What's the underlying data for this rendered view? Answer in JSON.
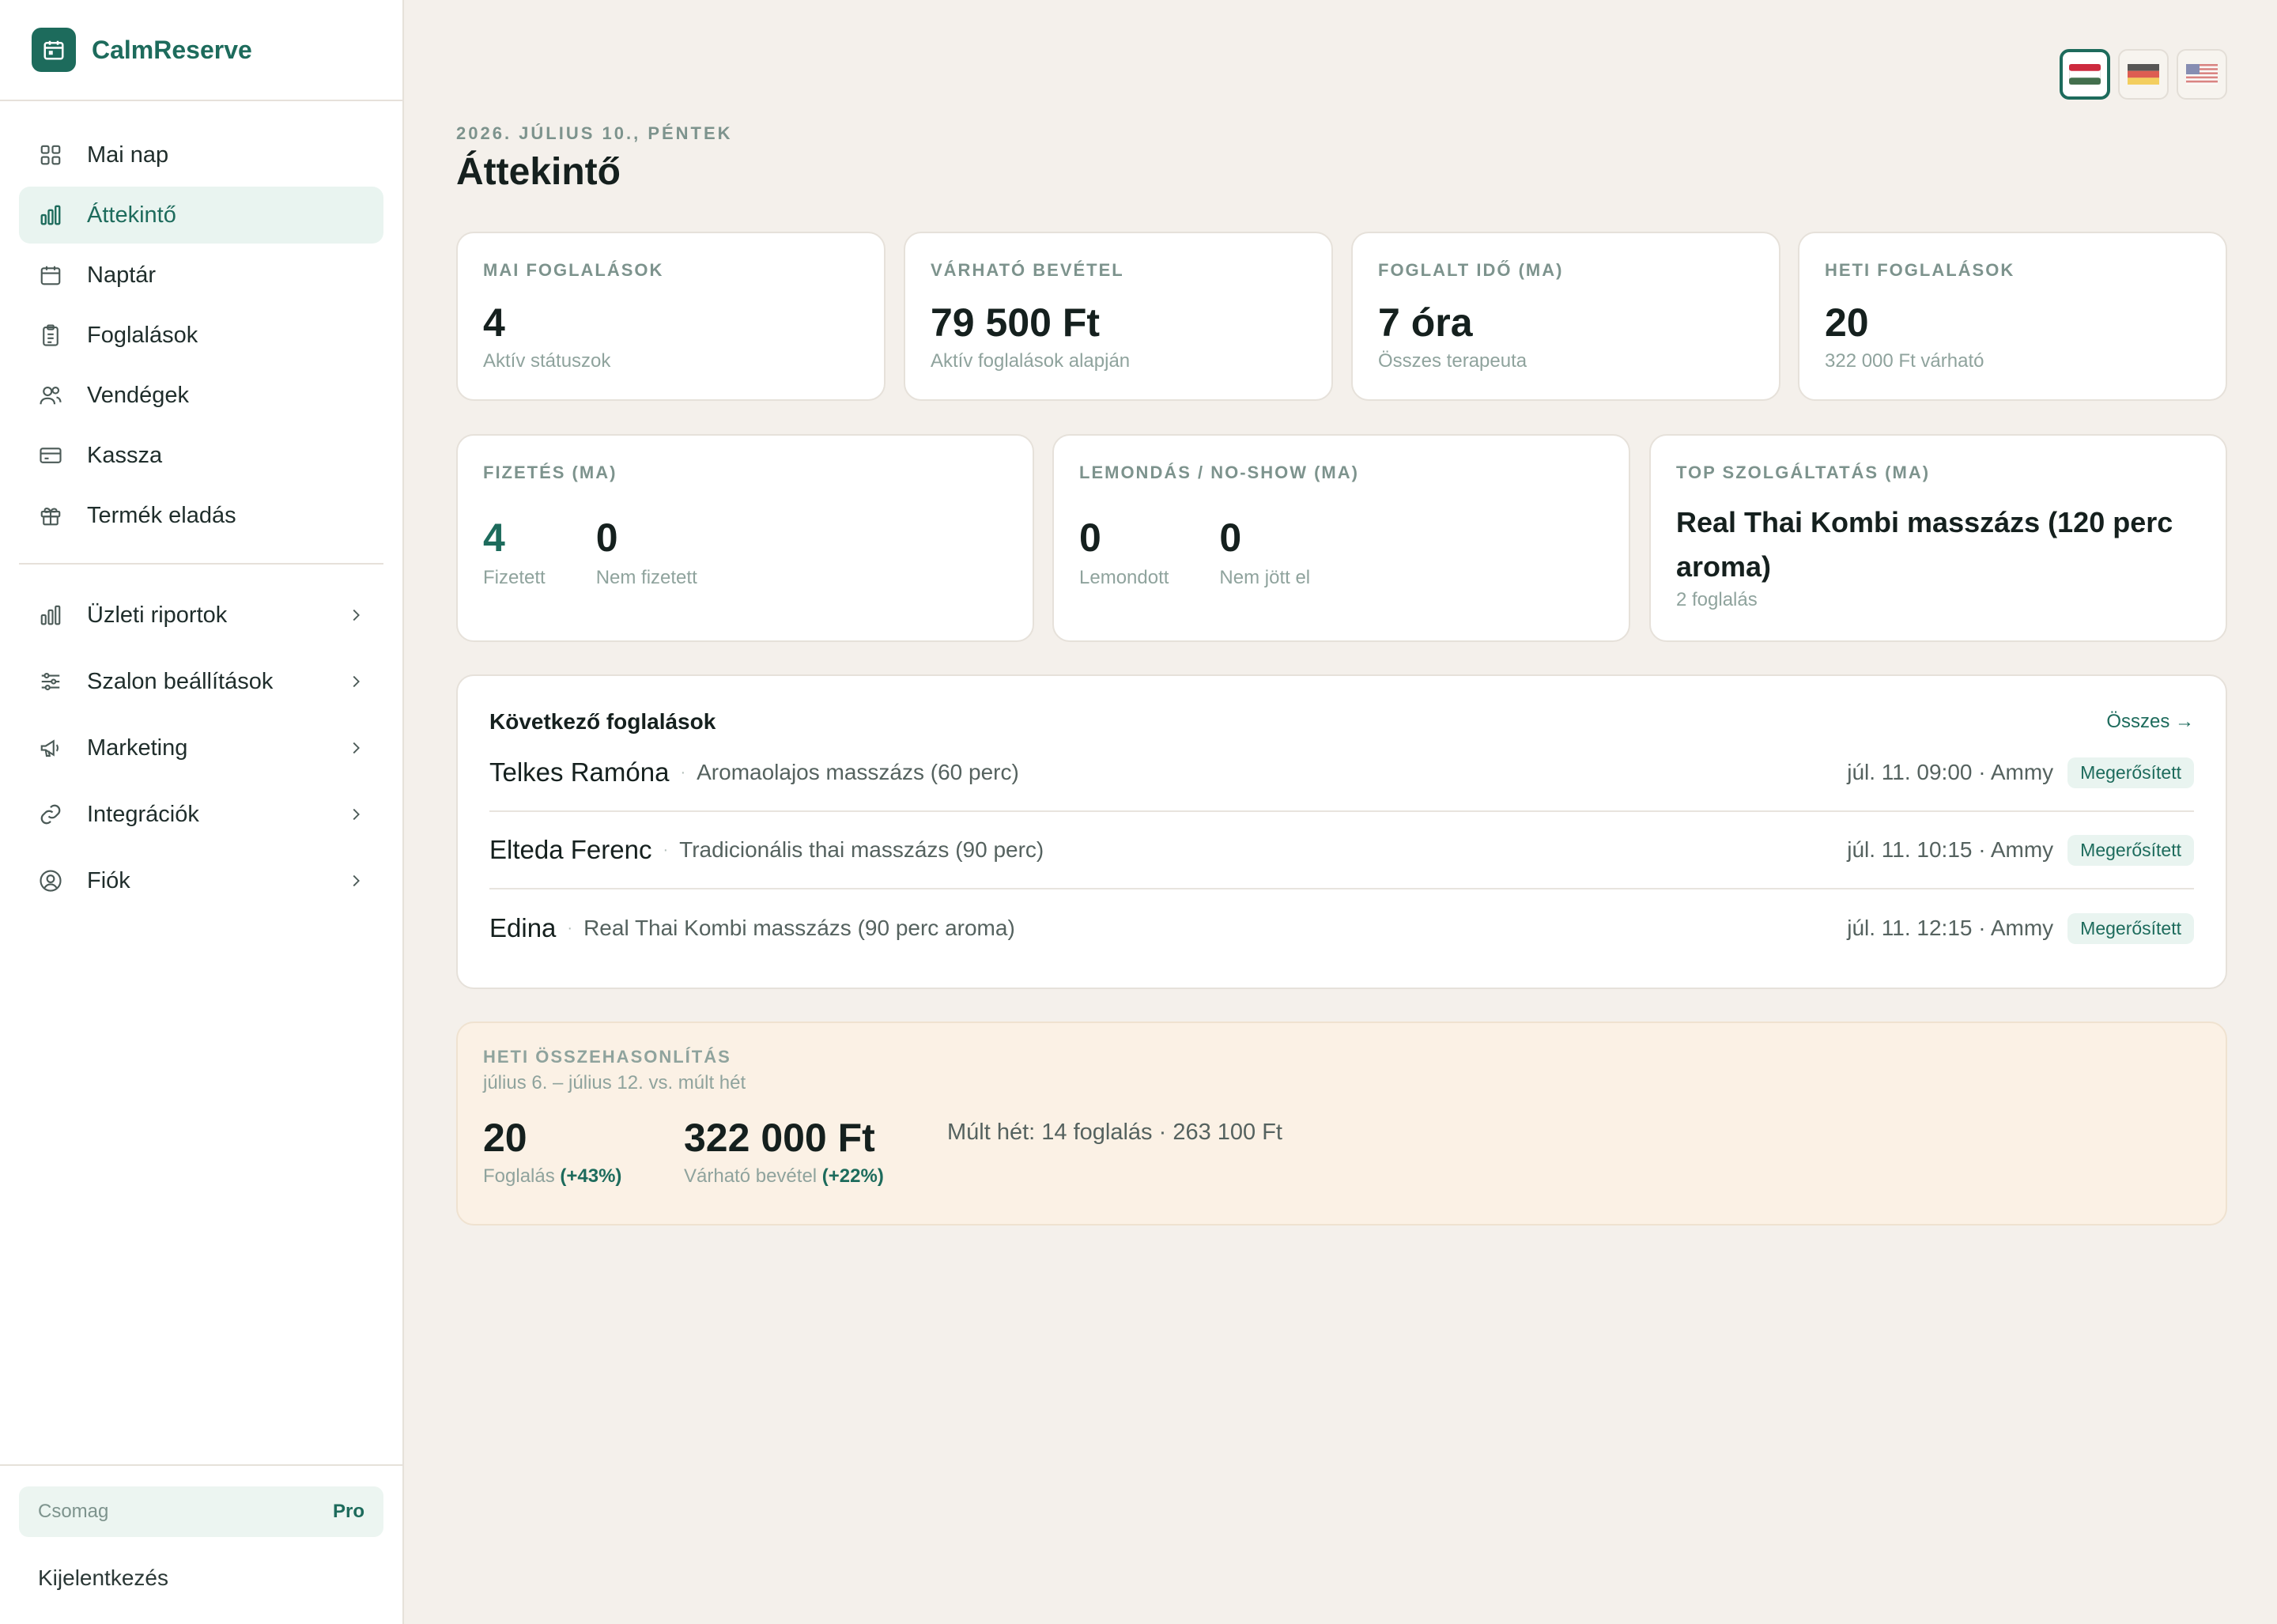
{
  "app": {
    "name": "CalmReserve"
  },
  "sidebar": {
    "items": [
      {
        "label": "Mai nap",
        "icon": "grid-icon"
      },
      {
        "label": "Áttekintő",
        "icon": "bar-chart-icon",
        "active": true
      },
      {
        "label": "Naptár",
        "icon": "calendar-icon"
      },
      {
        "label": "Foglalások",
        "icon": "clipboard-icon"
      },
      {
        "label": "Vendégek",
        "icon": "users-icon"
      },
      {
        "label": "Kassza",
        "icon": "credit-card-icon"
      },
      {
        "label": "Termék eladás",
        "icon": "gift-icon"
      }
    ],
    "groups": [
      {
        "label": "Üzleti riportok",
        "icon": "bar-chart-icon"
      },
      {
        "label": "Szalon beállítások",
        "icon": "sliders-icon"
      },
      {
        "label": "Marketing",
        "icon": "megaphone-icon"
      },
      {
        "label": "Integrációk",
        "icon": "link-icon"
      },
      {
        "label": "Fiók",
        "icon": "user-circle-icon"
      }
    ],
    "plan_label": "Csomag",
    "plan_value": "Pro",
    "logout": "Kijelentkezés"
  },
  "languages": [
    "hu",
    "de",
    "en-us"
  ],
  "active_language": "hu",
  "header": {
    "date": "2026. JÚLIUS 10., PÉNTEK",
    "title": "Áttekintő"
  },
  "stats": [
    {
      "label": "MAI FOGLALÁSOK",
      "value": "4",
      "sub": "Aktív státuszok"
    },
    {
      "label": "VÁRHATÓ BEVÉTEL",
      "value": "79 500 Ft",
      "sub": "Aktív foglalások alapján"
    },
    {
      "label": "FOGLALT IDŐ (MA)",
      "value": "7 óra",
      "sub": "Összes terapeuta"
    },
    {
      "label": "HETI FOGLALÁSOK",
      "value": "20",
      "sub": "322 000 Ft várható"
    }
  ],
  "payment": {
    "label": "FIZETÉS (MA)",
    "paid_value": "4",
    "paid_label": "Fizetett",
    "unpaid_value": "0",
    "unpaid_label": "Nem fizetett"
  },
  "cancellations": {
    "label": "LEMONDÁS / NO-SHOW (MA)",
    "cancelled_value": "0",
    "cancelled_label": "Lemondott",
    "noshow_value": "0",
    "noshow_label": "Nem jött el"
  },
  "top_service": {
    "label": "TOP SZOLGÁLTATÁS (MA)",
    "name": "Real Thai Kombi masszázs (120 perc aroma)",
    "sub": "2 foglalás"
  },
  "upcoming": {
    "title": "Következő foglalások",
    "all_link": "Összes →",
    "rows": [
      {
        "name": "Telkes Ramóna",
        "service": "Aromaolajos masszázs (60 perc)",
        "time": "júl. 11. 09:00 · Ammy",
        "status": "Megerősített"
      },
      {
        "name": "Elteda Ferenc",
        "service": "Tradicionális thai masszázs (90 perc)",
        "time": "júl. 11. 10:15 · Ammy",
        "status": "Megerősített"
      },
      {
        "name": "Edina",
        "service": "Real Thai Kombi masszázs (90 perc aroma)",
        "time": "júl. 11. 12:15 · Ammy",
        "status": "Megerősített"
      }
    ]
  },
  "weekly": {
    "label": "HETI ÖSSZEHASONLÍTÁS",
    "range": "július 6. – július 12. vs. múlt hét",
    "bookings_value": "20",
    "bookings_label": "Foglalás",
    "bookings_change": "(+43%)",
    "revenue_value": "322 000 Ft",
    "revenue_label": "Várható bevétel",
    "revenue_change": "(+22%)",
    "previous": "Múlt hét: 14 foglalás · 263 100 Ft"
  },
  "colors": {
    "accent": "#1d6b5c",
    "background": "#f4f0eb",
    "weekly_bg": "#fbf1e5"
  }
}
